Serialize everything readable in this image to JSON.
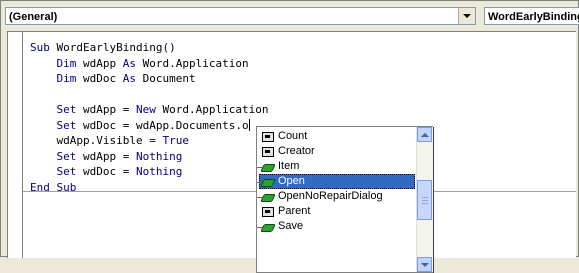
{
  "header": {
    "object_combo": "(General)",
    "procedure_combo": "WordEarlyBinding"
  },
  "code": {
    "lines": [
      [
        {
          "t": "Sub ",
          "k": true
        },
        {
          "t": "WordEarlyBinding()",
          "k": false
        }
      ],
      [
        {
          "t": "    ",
          "k": false
        },
        {
          "t": "Dim",
          "k": true
        },
        {
          "t": " wdApp ",
          "k": false
        },
        {
          "t": "As",
          "k": true
        },
        {
          "t": " Word.Application",
          "k": false
        }
      ],
      [
        {
          "t": "    ",
          "k": false
        },
        {
          "t": "Dim",
          "k": true
        },
        {
          "t": " wdDoc ",
          "k": false
        },
        {
          "t": "As",
          "k": true
        },
        {
          "t": " Document",
          "k": false
        }
      ],
      [],
      [
        {
          "t": "    ",
          "k": false
        },
        {
          "t": "Set",
          "k": true
        },
        {
          "t": " wdApp = ",
          "k": false
        },
        {
          "t": "New",
          "k": true
        },
        {
          "t": " Word.Application",
          "k": false
        }
      ],
      [
        {
          "t": "    ",
          "k": false
        },
        {
          "t": "Set",
          "k": true
        },
        {
          "t": " wdDoc = wdApp.Documents.o",
          "k": false
        },
        {
          "caret": true
        }
      ],
      [
        {
          "t": "    wdApp.Visible = ",
          "k": false
        },
        {
          "t": "True",
          "k": true
        }
      ],
      [
        {
          "t": "    ",
          "k": false
        },
        {
          "t": "Set",
          "k": true
        },
        {
          "t": " wdApp = ",
          "k": false
        },
        {
          "t": "Nothing",
          "k": true
        }
      ],
      [
        {
          "t": "    ",
          "k": false
        },
        {
          "t": "Set",
          "k": true
        },
        {
          "t": " wdDoc = ",
          "k": false
        },
        {
          "t": "Nothing",
          "k": true
        }
      ],
      [
        {
          "t": "End Sub",
          "k": true
        }
      ]
    ]
  },
  "autocomplete": {
    "items": [
      {
        "label": "Count",
        "icon": "property-icon",
        "selected": false
      },
      {
        "label": "Creator",
        "icon": "property-icon",
        "selected": false
      },
      {
        "label": "Item",
        "icon": "method-icon",
        "selected": false
      },
      {
        "label": "Open",
        "icon": "method-icon",
        "selected": true
      },
      {
        "label": "OpenNoRepairDialog",
        "icon": "method-icon",
        "selected": false
      },
      {
        "label": "Parent",
        "icon": "property-icon",
        "selected": false
      },
      {
        "label": "Save",
        "icon": "method-icon",
        "selected": false
      }
    ],
    "scroll_position": 0.5
  },
  "colors": {
    "keyword": "#00007f",
    "selection": "#316ac5"
  }
}
